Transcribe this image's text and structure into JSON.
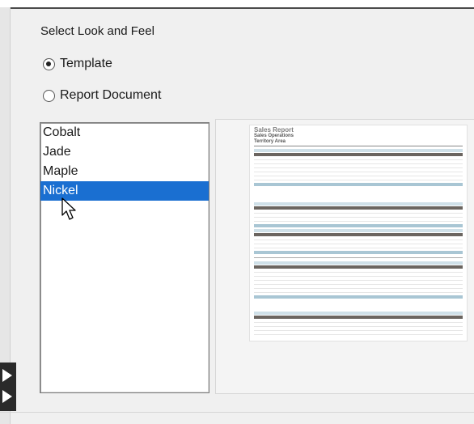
{
  "dialog": {
    "heading": "Select Look and Feel",
    "options": [
      {
        "label": "Template",
        "checked": true
      },
      {
        "label": "Report Document",
        "checked": false
      }
    ]
  },
  "look_and_feel_list": {
    "items": [
      "Cobalt",
      "Jade",
      "Maple",
      "Nickel"
    ],
    "selected": "Nickel"
  },
  "preview": {
    "report_title": "Sales Report",
    "report_subtitle": "Sales Operations",
    "report_subtitle2": "Territory Area"
  },
  "colors": {
    "selection": "#1a6fd1",
    "header_band": "#6b6560",
    "subtotal_band": "#a9c6d4",
    "group_band": "#cfe0e8"
  }
}
